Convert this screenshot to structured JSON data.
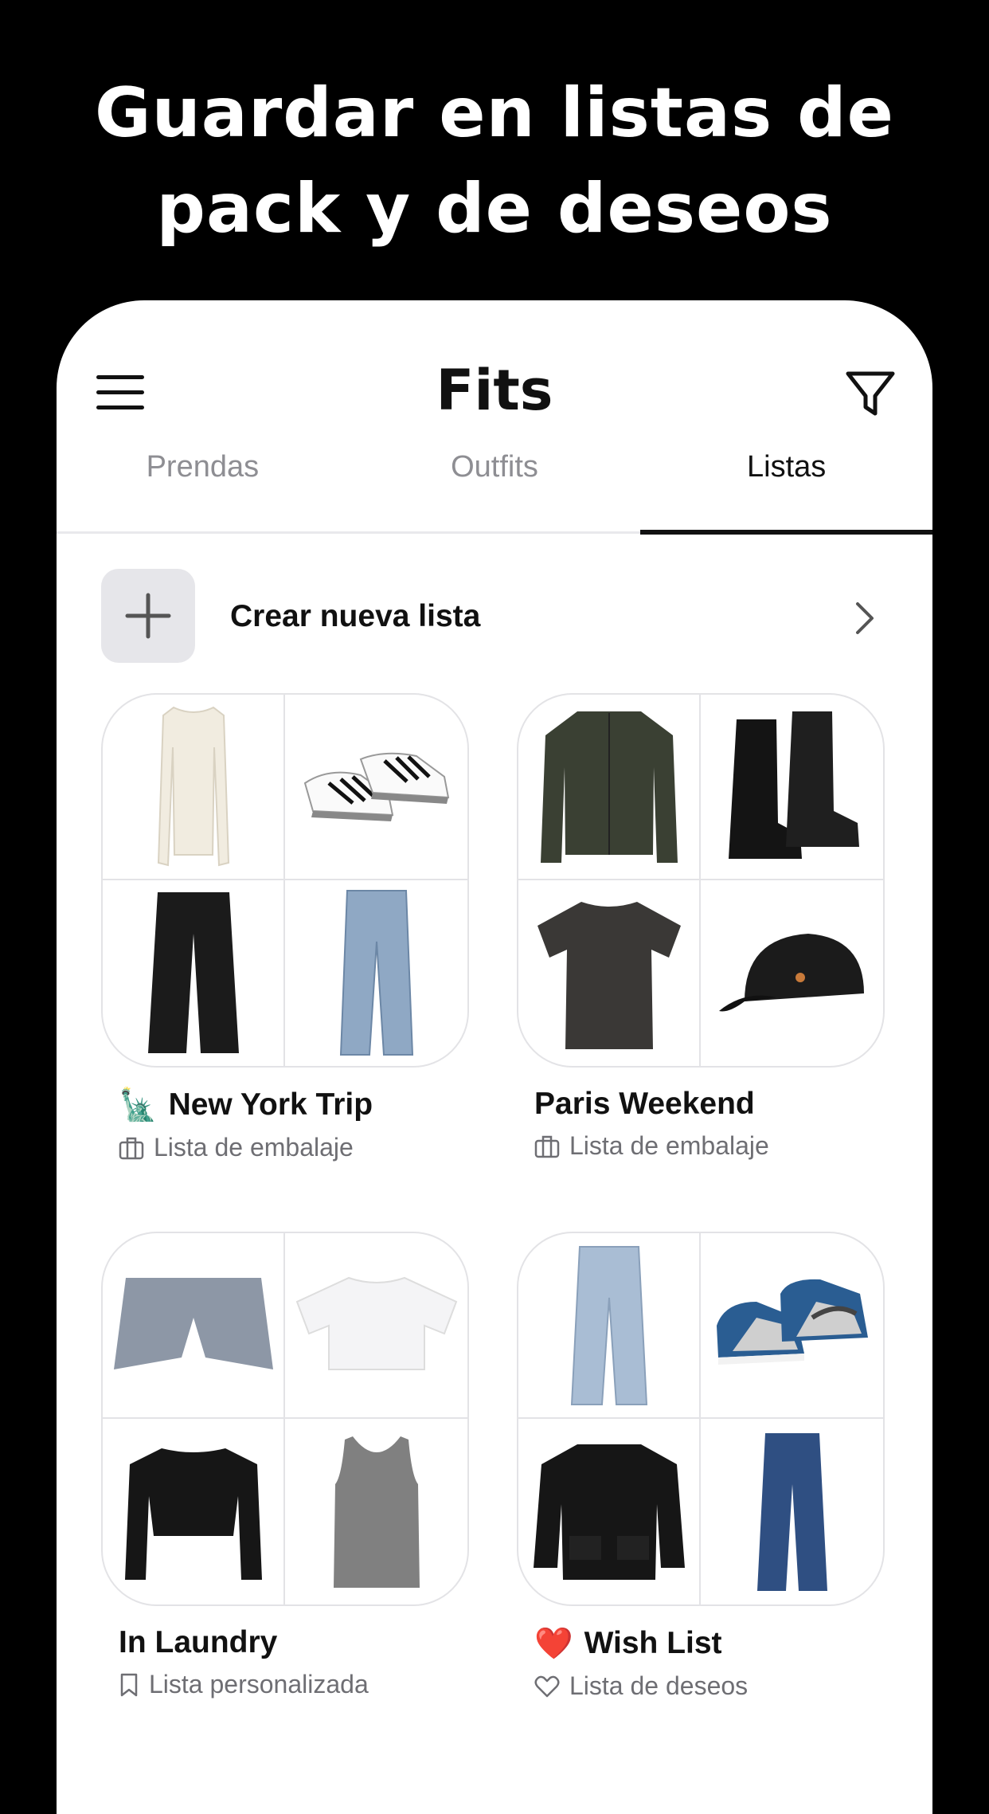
{
  "headline": {
    "line1": "Guardar en listas de",
    "line2": "pack y de deseos"
  },
  "app": {
    "title": "Fits",
    "menu_icon": "hamburger-menu-icon",
    "filter_icon": "filter-funnel-icon"
  },
  "tabs": [
    {
      "label": "Prendas",
      "active": false
    },
    {
      "label": "Outfits",
      "active": false
    },
    {
      "label": "Listas",
      "active": true
    }
  ],
  "create_list": {
    "label": "Crear nueva lista",
    "icon": "plus-icon",
    "chevron": "chevron-right-icon"
  },
  "lists": [
    {
      "emoji": "🗽",
      "name": "New York Trip",
      "type_icon": "suitcase-icon",
      "type": "Lista de embalaje",
      "items": [
        "cream-lace-top",
        "white-black-sneakers",
        "black-leather-pants",
        "light-wash-jeans"
      ]
    },
    {
      "emoji": "",
      "name": "Paris Weekend",
      "type_icon": "suitcase-icon",
      "type": "Lista de embalaje",
      "items": [
        "olive-bomber-jacket",
        "black-chelsea-boots",
        "charcoal-tshirt",
        "black-cap"
      ]
    },
    {
      "emoji": "",
      "name": "In Laundry",
      "type_icon": "bookmark-icon",
      "type": "Lista personalizada",
      "items": [
        "denim-skort",
        "white-crop-tee",
        "black-crop-sweater",
        "grey-tank-top"
      ]
    },
    {
      "emoji": "❤️",
      "name": "Wish List",
      "type_icon": "heart-icon",
      "type": "Lista de deseos",
      "items": [
        "light-straight-jeans",
        "blue-high-top-sneakers",
        "black-wool-jacket",
        "dark-wash-jeans"
      ]
    }
  ],
  "colors": {
    "background": "#000000",
    "surface": "#ffffff",
    "text": "#111111",
    "muted": "#8e8e93",
    "plus_bg": "#e6e6ea"
  }
}
